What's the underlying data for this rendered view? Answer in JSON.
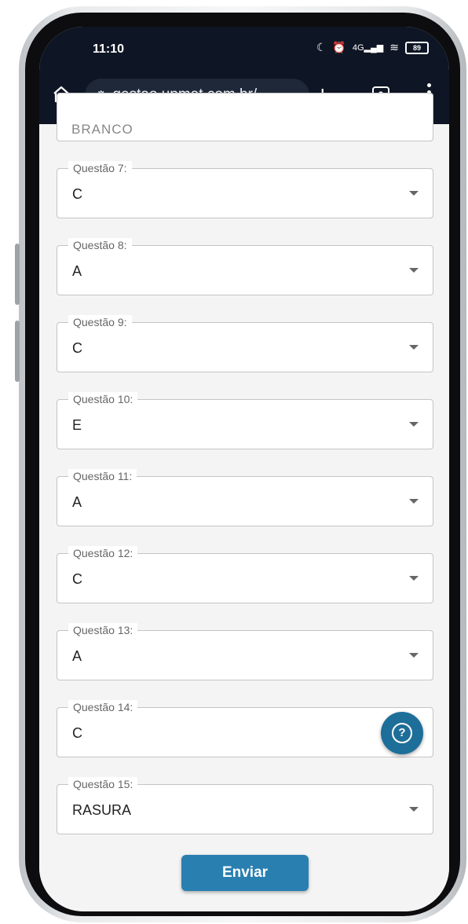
{
  "status_bar": {
    "time": "11:10",
    "battery": "89",
    "network": "4G"
  },
  "browser": {
    "url": "gestao.upmat.com.br/",
    "tab_count": "2"
  },
  "form": {
    "partial_field_value": "BRANCO",
    "questions": [
      {
        "label": "Questão 7:",
        "value": "C"
      },
      {
        "label": "Questão 8:",
        "value": "A"
      },
      {
        "label": "Questão 9:",
        "value": "C"
      },
      {
        "label": "Questão 10:",
        "value": "E"
      },
      {
        "label": "Questão 11:",
        "value": "A"
      },
      {
        "label": "Questão 12:",
        "value": "C"
      },
      {
        "label": "Questão 13:",
        "value": "A"
      },
      {
        "label": "Questão 14:",
        "value": "C"
      },
      {
        "label": "Questão 15:",
        "value": "RASURA"
      }
    ],
    "submit_label": "Enviar",
    "help_symbol": "?"
  },
  "icons": [
    "home-icon",
    "site-info-icon",
    "new-tab-icon",
    "tabs-icon",
    "menu-icon",
    "help-icon",
    "chevron-down-icon"
  ],
  "colors": {
    "browser_bar": "#0e1524",
    "submit_button": "#2a7fb1",
    "help_fab": "#1e6e9a"
  }
}
